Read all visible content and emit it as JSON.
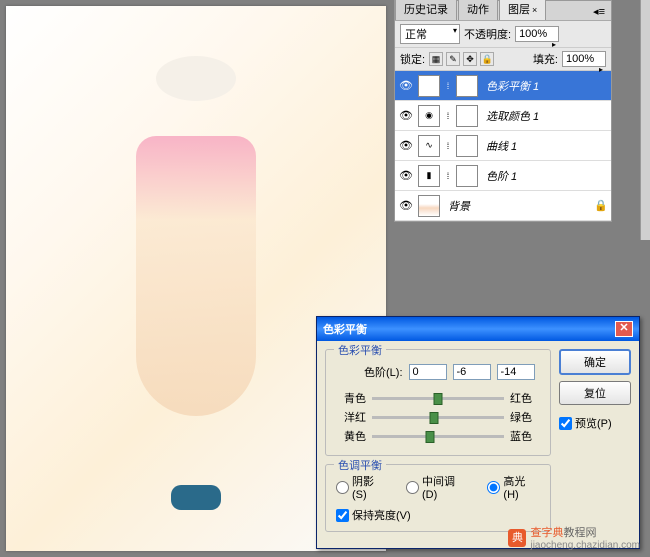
{
  "layers_panel": {
    "tabs": {
      "history": "历史记录",
      "actions": "动作",
      "layers": "图层"
    },
    "blend_mode": "正常",
    "opacity_label": "不透明度:",
    "opacity_value": "100%",
    "lock_label": "锁定:",
    "fill_label": "填充:",
    "fill_value": "100%",
    "items": [
      {
        "name": "色彩平衡 1",
        "icon": "◑"
      },
      {
        "name": "选取颜色 1",
        "icon": "◉"
      },
      {
        "name": "曲线 1",
        "icon": "∿"
      },
      {
        "name": "色阶 1",
        "icon": "▮"
      }
    ],
    "bg_name": "背景",
    "bg_lock": "🔒"
  },
  "dialog": {
    "title": "色彩平衡",
    "section1": "色彩平衡",
    "levels_label": "色阶(L):",
    "v1": "0",
    "v2": "-6",
    "v3": "-14",
    "sliders": [
      {
        "left": "青色",
        "right": "红色",
        "pos": 50
      },
      {
        "left": "洋红",
        "right": "绿色",
        "pos": 47
      },
      {
        "left": "黄色",
        "right": "蓝色",
        "pos": 44
      }
    ],
    "section2": "色调平衡",
    "r_shadow": "阴影(S)",
    "r_mid": "中间调(D)",
    "r_high": "高光(H)",
    "preserve": "保持亮度(V)",
    "ok": "确定",
    "reset": "复位",
    "preview": "预览(P)"
  },
  "watermark": {
    "text": "查字典",
    "suffix": "教程网",
    "url": "jiaocheng.chazidian.com"
  }
}
